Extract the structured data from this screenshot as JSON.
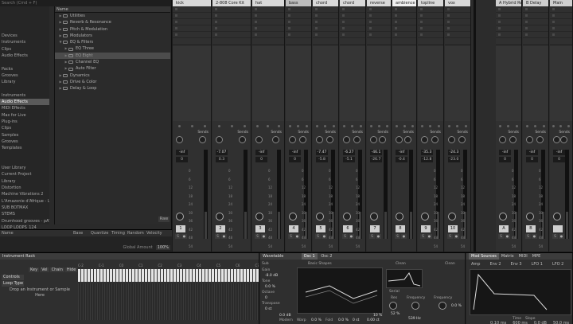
{
  "browser": {
    "search_text": "Search (Cmd + F)",
    "places": [
      "",
      "",
      "",
      "",
      "Devices",
      "Instruments",
      "Clips",
      "Audio Effects",
      "",
      "Packs",
      "Grooves",
      "Library",
      "",
      "Instruments",
      "Audio Effects",
      "MIDI Effects",
      "Max for Live",
      "Plug-ins",
      "Clips",
      "Samples",
      "Grooves",
      "Templates",
      "",
      "",
      "User Library",
      "Current Project",
      "Library",
      "Distortion",
      "Machine Vibrations 2",
      "L'Amazonie d'Afrique - Love fe",
      "SUB BOTMAX",
      "STEMS",
      "Drumhood grooves - pATCHED",
      "LOOP LOOPS_124"
    ],
    "tree_header": "Name",
    "tree": [
      {
        "label": "Utilities",
        "depth": 0,
        "open": false
      },
      {
        "label": "Reverb & Resonance",
        "depth": 0,
        "open": false
      },
      {
        "label": "Pitch & Modulation",
        "depth": 0,
        "open": false
      },
      {
        "label": "Modulators",
        "depth": 0,
        "open": false
      },
      {
        "label": "EQ & Filters",
        "depth": 0,
        "open": true
      },
      {
        "label": "EQ Three",
        "depth": 1,
        "open": false
      },
      {
        "label": "EQ Eight",
        "depth": 1,
        "open": false,
        "selected": true
      },
      {
        "label": "Channel EQ",
        "depth": 1,
        "open": false
      },
      {
        "label": "Auto Filter",
        "depth": 1,
        "open": false
      },
      {
        "label": "Dynamics",
        "depth": 0,
        "open": false
      },
      {
        "label": "Drive & Color",
        "depth": 0,
        "open": false
      },
      {
        "label": "Delay & Loop",
        "depth": 0,
        "open": false
      }
    ],
    "raw_label": "Raw"
  },
  "groove": {
    "headers": [
      "Name",
      "Base",
      "Quantize",
      "Timing",
      "Random",
      "Velocity"
    ],
    "footer_label": "Global Amount",
    "footer_value": "100%"
  },
  "tracks": [
    {
      "name": "kick",
      "number": "1",
      "vol": "-inf",
      "peak": "0",
      "color": "#d9d9d9"
    },
    {
      "name": "2-808 Core Kit",
      "number": "2",
      "vol": "-7.07",
      "peak": "0.3",
      "color": "#d9d9d9"
    },
    {
      "name": "hat",
      "number": "3",
      "vol": "-inf",
      "peak": "0",
      "color": "#d9d9d9"
    },
    {
      "name": "bass",
      "number": "4",
      "vol": "-inf",
      "peak": "0",
      "color": "#bdbdbd"
    },
    {
      "name": "chord",
      "number": "5",
      "vol": "-7.47",
      "peak": "-5.8",
      "color": "#d9d9d9"
    },
    {
      "name": "chord",
      "number": "6",
      "vol": "-6.27",
      "peak": "-5.1",
      "color": "#d9d9d9"
    },
    {
      "name": "reverse",
      "number": "7",
      "vol": "-46.1",
      "peak": "-26.7",
      "color": "#d9d9d9"
    },
    {
      "name": "ambience",
      "number": "8",
      "vol": "-inf",
      "peak": "-0.4",
      "color": "#f0f0f0"
    },
    {
      "name": "topline",
      "number": "9",
      "vol": "-35.3",
      "peak": "-12.8",
      "color": "#d9d9d9"
    },
    {
      "name": "vox",
      "number": "10",
      "vol": "-24.3",
      "peak": "-23.0",
      "color": "#d9d9d9"
    },
    {
      "name": "A Hybrid Reverb",
      "number": "A",
      "vol": "-inf",
      "peak": "0",
      "color": "#cfcfcf"
    },
    {
      "name": "B Delay",
      "number": "B",
      "vol": "-inf",
      "peak": "0",
      "color": "#cfcfcf"
    },
    {
      "name": "Main",
      "number": "",
      "vol": "-inf",
      "peak": "0",
      "color": "#cfcfcf"
    }
  ],
  "sends_label": "Sends",
  "meter_scale": [
    "0",
    "6",
    "12",
    "18",
    "24",
    "30",
    "36",
    "42",
    "48",
    "54",
    "60"
  ],
  "devices": {
    "rack": {
      "title": "Instrument Rack",
      "chain_buttons": [
        "Key",
        "Vel",
        "Chain",
        "Hide"
      ],
      "params": [
        "Controls",
        "Loop Type"
      ],
      "drop_msg": "Drop an Instrument or Sample Here",
      "key_labels": [
        "C-2",
        "C-1",
        "C0",
        "C1",
        "C2",
        "C3",
        "C4",
        "C5",
        "C6",
        "C7"
      ]
    },
    "wavetable": {
      "title": "Wavetable",
      "osc1_tab": "Osc 1",
      "osc2_tab": "Osc 2",
      "sub_tab": "Sub",
      "basic_shapes": "Basic Shapes",
      "gain_label": "Gain",
      "gain_value": "-8.0 dB",
      "tone_label": "Tone",
      "tone_value": "0.0 %",
      "octave_label": "Octave",
      "octave_value": "0",
      "transpose_label": "Transpose",
      "transpose_value": "0 st",
      "mod_label": "Modern",
      "warp_label": "Warp",
      "warp_value": "0.0 %",
      "fold_label": "Fold",
      "fold_value": "0.0 %",
      "semi_value": "0 st",
      "det_value": "0.00 ct",
      "filter_type": "Clean",
      "filter2_type": "Clean",
      "res_label": "Res",
      "res_value": "52 %",
      "freq_label": "Frequency",
      "freq_value": "539 Hz",
      "freq2_label": "Frequency",
      "freq2_value": "",
      "res2_value": "0.0 %",
      "serial": "Serial",
      "pct_value": "10 %",
      "drive_value": "0.0 dB"
    },
    "mod": {
      "tabs": [
        "Mod Sources",
        "Matrix",
        "MIDI",
        "MPE"
      ],
      "env_tabs": [
        "Amp",
        "Env 2",
        "Env 3",
        "LFO 1",
        "LFO 2"
      ],
      "time_label": "Time",
      "slope_label": "Slope",
      "vals": [
        "0.10 ms",
        "600 ms",
        "0.0 dB",
        "50.0 ms"
      ]
    }
  }
}
